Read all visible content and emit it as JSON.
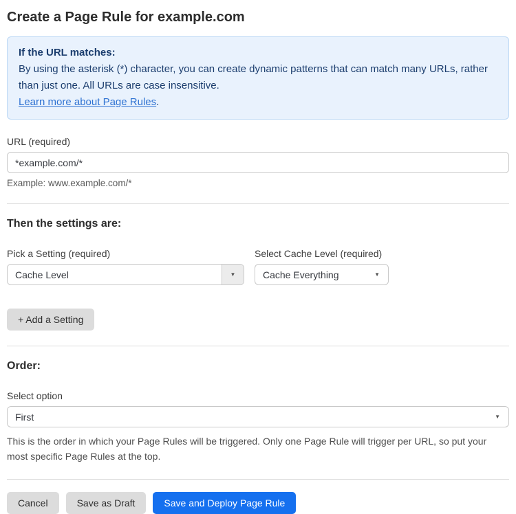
{
  "page": {
    "title": "Create a Page Rule for example.com"
  },
  "info_box": {
    "heading": "If the URL matches:",
    "body": "By using the asterisk (*) character, you can create dynamic patterns that can match many URLs, rather than just one. All URLs are case insensitive.",
    "link_label": "Learn more about Page Rules",
    "link_suffix": "."
  },
  "url_field": {
    "label": "URL (required)",
    "value": "*example.com/*",
    "example": "Example: www.example.com/*"
  },
  "settings": {
    "heading": "Then the settings are:",
    "pick_setting": {
      "label": "Pick a Setting (required)",
      "value": "Cache Level"
    },
    "cache_level": {
      "label": "Select Cache Level (required)",
      "value": "Cache Everything"
    },
    "add_setting_label": "+ Add a Setting"
  },
  "order": {
    "heading": "Order:",
    "select_label": "Select option",
    "value": "First",
    "help": "This is the order in which your Page Rules will be triggered. Only one Page Rule will trigger per URL, so put your most specific Page Rules at the top."
  },
  "footer": {
    "cancel_label": "Cancel",
    "save_draft_label": "Save as Draft",
    "save_deploy_label": "Save and Deploy Page Rule"
  },
  "colors": {
    "accent_blue": "#1570ef",
    "info_bg": "#e9f2fd",
    "info_border": "#bcd8f5",
    "info_text": "#1b3d6e",
    "link_blue": "#2e72d2"
  },
  "icons": {
    "dropdown_arrow": "▼"
  }
}
